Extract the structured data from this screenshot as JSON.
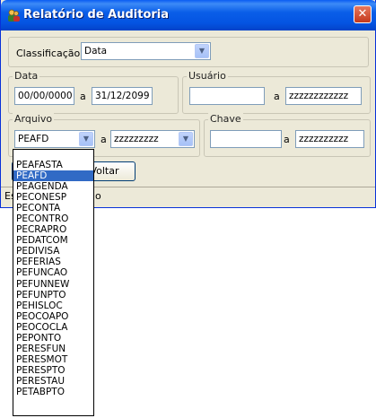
{
  "window": {
    "title": "Relatório de Auditoria",
    "close_glyph": "✕"
  },
  "classificacao": {
    "label": "Classificação:",
    "value": "Data"
  },
  "data_group": {
    "legend": "Data",
    "from": "00/00/0000",
    "sep": "a",
    "to": "31/12/2099"
  },
  "usuario_group": {
    "legend": "Usuário",
    "from": "",
    "sep": "a",
    "to": "zzzzzzzzzzzz"
  },
  "arquivo_group": {
    "legend": "Arquivo",
    "from": "PEAFD",
    "sep": "a",
    "to": "zzzzzzzzz"
  },
  "chave_group": {
    "legend": "Chave",
    "from": "",
    "sep": "a",
    "to": "zzzzzzzzzz"
  },
  "buttons": {
    "voltar": "Voltar"
  },
  "status": {
    "left": "Es",
    "right": "o"
  },
  "dropdown": {
    "items": [
      "PEAFASTA",
      "PEAFD",
      "PEAGENDA",
      "PECONESP",
      "PECONTA",
      "PECONTRO",
      "PECRAPRO",
      "PEDATCOM",
      "PEDIVISA",
      "PEFERIAS",
      "PEFUNCAO",
      "PEFUNNEW",
      "PEFUNPTO",
      "PEHISLOC",
      "PEOCOAPO",
      "PEOCOCLA",
      "PEPONTO",
      "PERESFUN",
      "PERESMOT",
      "PERESPTO",
      "PERESTAU",
      "PETABPTO"
    ],
    "selected_index": 1
  },
  "icons": {
    "app": "people-icon",
    "combo_arrow": "chevron-down-icon"
  },
  "colors": {
    "titlebar": "#0a5ee8",
    "window_bg": "#ece9d8",
    "selection": "#316ac5",
    "close": "#d9522d"
  }
}
